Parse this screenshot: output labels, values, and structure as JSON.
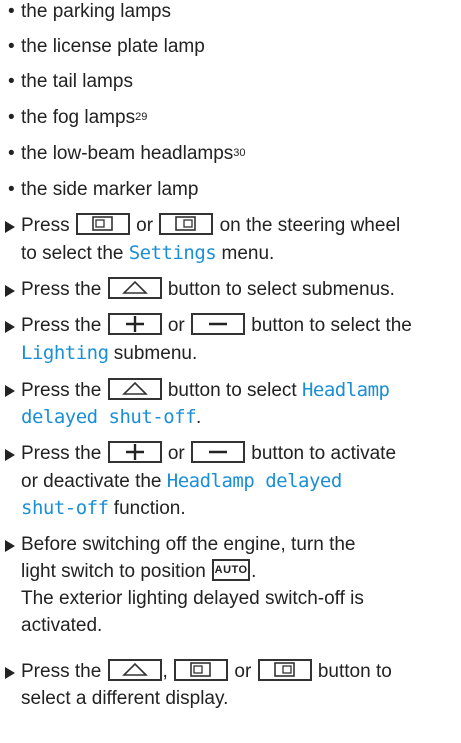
{
  "bullets": [
    "the parking lamps",
    "the license plate lamp",
    "the tail lamps",
    "the fog lamps",
    "the low-beam headlamps",
    "the side marker lamp"
  ],
  "footnotes": {
    "fog": "29",
    "lowbeam": "30"
  },
  "bullet_char": "•",
  "steps": {
    "s1_a": "Press",
    "s1_b": "or",
    "s1_c": "on the steering wheel",
    "s1_d": "to select the",
    "s1_menu": "Settings",
    "s1_e": "menu.",
    "s2_a": "Press the",
    "s2_b": "button to select submenus.",
    "s3_a": "Press the",
    "s3_b": "or",
    "s3_c": "button to select the",
    "s3_menu": "Lighting",
    "s3_d": "submenu.",
    "s4_a": "Press the",
    "s4_b": "button to select",
    "s4_menu1": "Headlamp",
    "s4_menu2": "delayed shut-off",
    "s4_c": ".",
    "s5_a": "Press the",
    "s5_b": "or",
    "s5_c": "button to activate",
    "s5_d": "or deactivate the",
    "s5_menu1": "Headlamp delayed",
    "s5_menu2": "shut-off",
    "s5_e": "function.",
    "s6_a": "Before switching off the engine, turn the",
    "s6_b": "light switch to position",
    "s6_key": "AUTO",
    "s6_c": ".",
    "s6_d": "The exterior lighting delayed switch-off is",
    "s6_e": "activated.",
    "s7_a": "Press the",
    "s7_b": ",",
    "s7_c": "or",
    "s7_d": "button to",
    "s7_e": "select a different display."
  }
}
